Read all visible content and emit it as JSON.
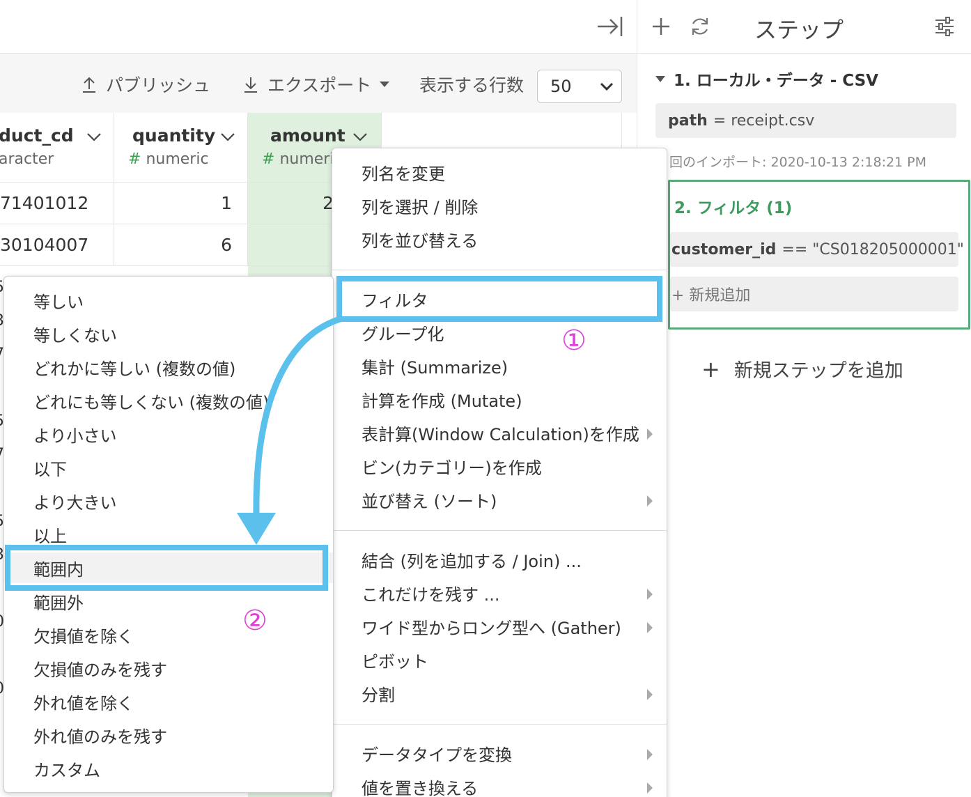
{
  "toolbar": {
    "publish_label": "パブリッシュ",
    "export_label": "エクスポート",
    "rows_label": "表示する行数",
    "rows_value": "50"
  },
  "table": {
    "columns": [
      {
        "name": "duct_cd",
        "type": "aracter"
      },
      {
        "name": "quantity",
        "type": "numeric"
      },
      {
        "name": "amount",
        "type": "numeri"
      }
    ],
    "rows": [
      [
        "71401012",
        "1",
        "2"
      ],
      [
        "30104007",
        "6",
        ""
      ]
    ],
    "left_edge_glyphs": [
      "5",
      "3",
      "7",
      "-",
      "5",
      "7",
      "-",
      "5",
      "3",
      "-",
      "0",
      "-",
      "0",
      "-"
    ]
  },
  "steps": {
    "title": "ステップ",
    "step1": {
      "title": "1. ローカル・データ - CSV",
      "param_key": "path",
      "param_value": "= receipt.csv",
      "import_note": "回のインポート: 2020-10-13 2:18:21 PM"
    },
    "step2": {
      "title": "2. フィルタ (1)",
      "cond_key": "customer_id",
      "cond_value": "== \"CS018205000001\"",
      "add_label": "+ 新規追加"
    },
    "add_step_label": "新規ステップを追加"
  },
  "menu_main": {
    "items": [
      "列名を変更",
      "列を選択 / 削除",
      "列を並び替える",
      "フィルタ",
      "グループ化",
      "集計 (Summarize)",
      "計算を作成 (Mutate)",
      "表計算(Window Calculation)を作成",
      "ビン(カテゴリー)を作成",
      "並び替え (ソート)",
      "結合 (列を追加する / Join) ...",
      "これだけを残す ...",
      "ワイド型からロング型へ (Gather)",
      "ピボット",
      "分割",
      "データタイプを変換",
      "値を置き換える"
    ]
  },
  "menu_sub": {
    "items": [
      "等しい",
      "等しくない",
      "どれかに等しい (複数の値)",
      "どれにも等しくない (複数の値)",
      "より小さい",
      "以下",
      "より大きい",
      "以上",
      "範囲内",
      "範囲外",
      "欠損値を除く",
      "欠損値のみを残す",
      "外れ値を除く",
      "外れ値のみを残す",
      "カスタム"
    ]
  },
  "annotations": {
    "num1": "①",
    "num2": "②"
  },
  "colors": {
    "highlight": "#5bc0eb",
    "annotation_number": "#e040d8",
    "step_green": "#3f9a5d",
    "amount_column_bg": "#dff0df"
  }
}
